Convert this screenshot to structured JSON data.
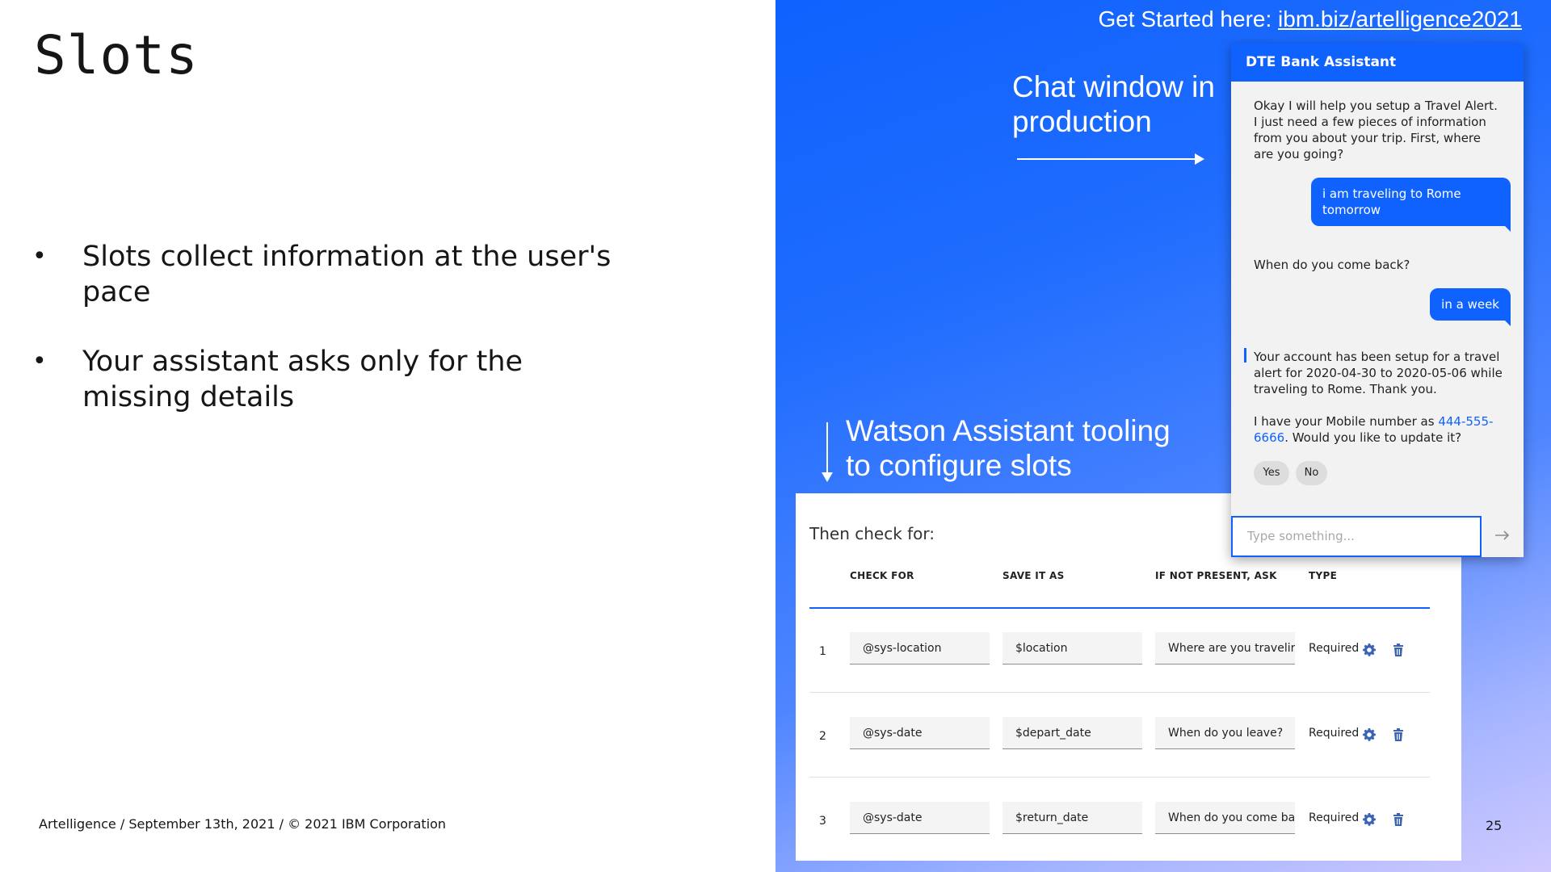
{
  "slide": {
    "title": "Slots",
    "bullets": [
      "Slots collect information at the user's pace",
      "Your assistant asks only for the missing details"
    ],
    "footer": "Artelligence / September 13th, 2021 / © 2021 IBM Corporation",
    "page_number": "25"
  },
  "banner": {
    "prefix": "Get Started here: ",
    "link": "ibm.biz/artelligence2021"
  },
  "callouts": {
    "chat": "Chat window in production",
    "tooling": "Watson Assistant tooling to configure slots"
  },
  "tooling": {
    "heading": "Then check for:",
    "columns": [
      "CHECK FOR",
      "SAVE IT AS",
      "IF NOT PRESENT, ASK",
      "TYPE"
    ],
    "rows": [
      {
        "num": "1",
        "check": "@sys-location",
        "save": "$location",
        "ask": "Where are you travelir",
        "type": "Required"
      },
      {
        "num": "2",
        "check": "@sys-date",
        "save": "$depart_date",
        "ask": "When do you leave?",
        "type": "Required"
      },
      {
        "num": "3",
        "check": "@sys-date",
        "save": "$return_date",
        "ask": "When do you come ba",
        "type": "Required"
      }
    ]
  },
  "chat": {
    "header": "DTE Bank Assistant",
    "bot1": "Okay I will help you setup a Travel Alert. I just need a few pieces of information from you about your trip. First, where are you going?",
    "user1": "i am traveling to Rome tomorrow",
    "bot2": "When do you come back?",
    "user2": "in a week",
    "bot3": "Your account has been setup for a travel alert for 2020-04-30 to 2020-05-06 while traveling to Rome. Thank you.",
    "bot4_prefix": "I have your Mobile number as ",
    "bot4_phone": "444-555-6666",
    "bot4_suffix": ". Would you like to update it?",
    "option_yes": "Yes",
    "option_no": "No",
    "input_placeholder": "Type something..."
  },
  "colors": {
    "brand_blue": "#0f62fe",
    "icon_blue": "#3a63b8"
  }
}
